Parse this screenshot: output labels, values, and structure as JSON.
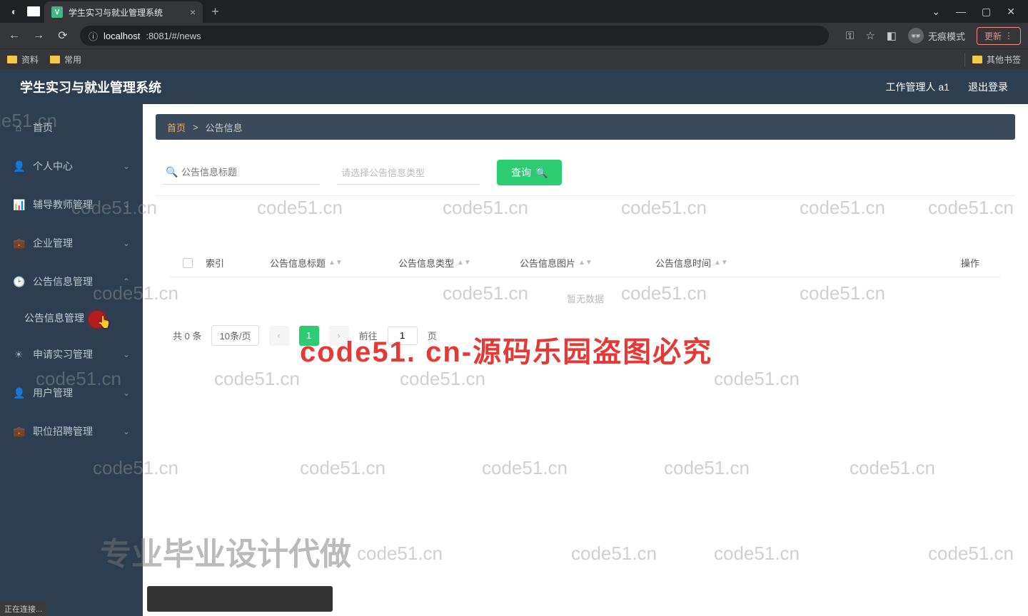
{
  "browser": {
    "tab_title": "学生实习与就业管理系统",
    "tab_favicon": "V",
    "url_host": "localhost",
    "url_tail": ":8081/#/news",
    "incognito_label": "无痕模式",
    "update_label": "更新",
    "bookmarks": {
      "b1": "资料",
      "b2": "常用",
      "other": "其他书签"
    },
    "status": "正在连接..."
  },
  "header": {
    "app_title": "学生实习与就业管理系统",
    "user_label": "工作管理人 a1",
    "logout": "退出登录"
  },
  "sidebar": {
    "home": "首页",
    "personal": "个人中心",
    "teacher": "辅导教师管理",
    "company": "企业管理",
    "notice": "公告信息管理",
    "notice_sub": "公告信息管理",
    "intern": "申请实习管理",
    "user": "用户管理",
    "job": "职位招聘管理"
  },
  "breadcrumb": {
    "home": "首页",
    "sep": ">",
    "current": "公告信息"
  },
  "search": {
    "title_placeholder": "公告信息标题",
    "type_placeholder": "请选择公告信息类型",
    "query_btn": "查询"
  },
  "table": {
    "cols": {
      "idx": "索引",
      "title": "公告信息标题",
      "type": "公告信息类型",
      "pic": "公告信息图片",
      "time": "公告信息时间",
      "op": "操作"
    },
    "empty": "暂无数据"
  },
  "pager": {
    "total_prefix": "共 ",
    "total_count": "0",
    "total_suffix": " 条",
    "page_size": "10条/页",
    "current": "1",
    "goto_prefix": "前往",
    "goto_value": "1",
    "goto_suffix": "页"
  },
  "watermark": {
    "text": "code51.cn",
    "red": "code51. cn-源码乐园盗图必究",
    "grey_big": "专业毕业设计代做"
  }
}
